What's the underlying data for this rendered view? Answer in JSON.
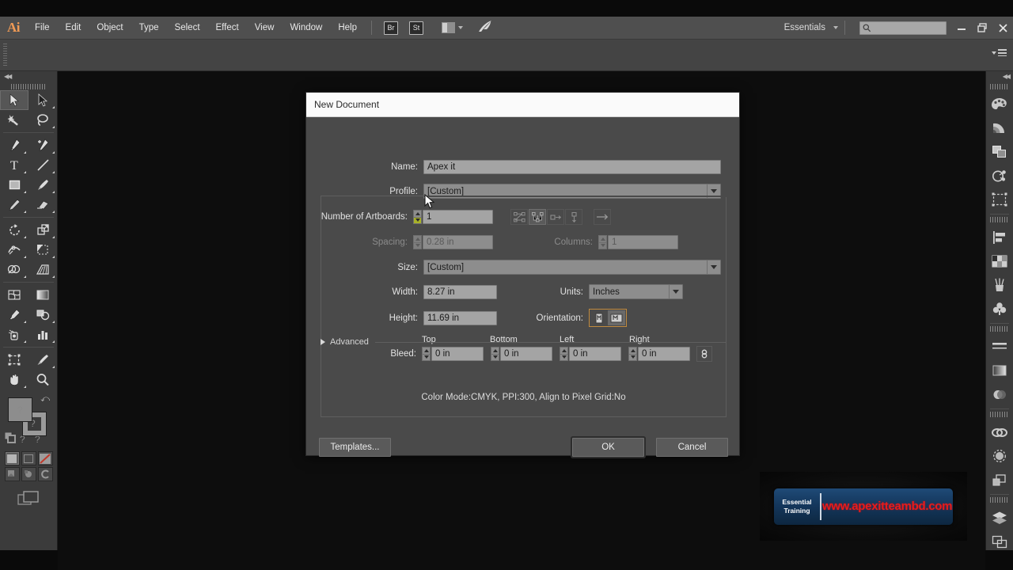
{
  "app": {
    "logo": "Ai",
    "menus": [
      "File",
      "Edit",
      "Object",
      "Type",
      "Select",
      "Effect",
      "View",
      "Window",
      "Help"
    ],
    "bridge_button": "Br",
    "stock_button": "St",
    "arrange_icon": "arrange-documents-icon",
    "feather_icon": "behance-feather-icon",
    "workspace": "Essentials",
    "search_placeholder": "",
    "search_value": "",
    "window_buttons": {
      "minimize": "–",
      "restore": "❐",
      "close": "✕"
    }
  },
  "toolbar": {
    "tools": [
      {
        "name": "selection-tool",
        "selected": true
      },
      {
        "name": "direct-selection-tool",
        "selected": false
      },
      {
        "name": "magic-wand-tool",
        "selected": false
      },
      {
        "name": "lasso-tool",
        "selected": false
      },
      {
        "name": "pen-tool",
        "selected": false
      },
      {
        "name": "add-anchor-point-tool",
        "selected": false
      },
      {
        "name": "type-tool",
        "selected": false
      },
      {
        "name": "line-segment-tool",
        "selected": false
      },
      {
        "name": "rectangle-tool",
        "selected": false
      },
      {
        "name": "paintbrush-tool",
        "selected": false
      },
      {
        "name": "pencil-tool",
        "selected": false
      },
      {
        "name": "eraser-tool",
        "selected": false
      },
      {
        "name": "rotate-tool",
        "selected": false
      },
      {
        "name": "scale-tool",
        "selected": false
      },
      {
        "name": "width-tool",
        "selected": false
      },
      {
        "name": "shape-builder-tool",
        "selected": false
      },
      {
        "name": "perspective-grid-tool",
        "selected": false
      },
      {
        "name": "mesh-tool",
        "selected": false
      },
      {
        "name": "gradient-tool",
        "selected": false
      },
      {
        "name": "eyedropper-tool",
        "selected": false
      },
      {
        "name": "blend-tool",
        "selected": false
      },
      {
        "name": "symbol-sprayer-tool",
        "selected": false
      },
      {
        "name": "column-graph-tool",
        "selected": false
      },
      {
        "name": "artboard-tool",
        "selected": false
      },
      {
        "name": "slice-tool",
        "selected": false
      },
      {
        "name": "hand-tool",
        "selected": false
      },
      {
        "name": "zoom-tool",
        "selected": false
      }
    ],
    "fill_color": "#8d8d8d",
    "stroke_color": "#9a9a9a",
    "color_modes": [
      "color-swatch",
      "gradient-swatch",
      "none-swatch"
    ],
    "draw_modes": [
      "draw-normal",
      "draw-behind",
      "draw-inside"
    ],
    "screen_mode": "change-screen-mode"
  },
  "dock": {
    "panels": [
      "color-panel",
      "color-guide-panel",
      "transform-panel",
      "pathfinder-panel",
      "align-panel",
      "align-objects-panel",
      "swatches-panel",
      "brushes-panel",
      "symbols-panel",
      "stroke-panel",
      "gradient-panel",
      "transparency-panel",
      "appearance-panel",
      "graphic-styles-panel",
      "layers-panel-alt",
      "layers-panel",
      "artboards-panel"
    ]
  },
  "dialog": {
    "title": "New Document",
    "fields": {
      "name_label": "Name:",
      "name_value": "Apex it",
      "profile_label": "Profile:",
      "profile_value": "[Custom]",
      "artboards_label": "Number of Artboards:",
      "artboards_value": "1",
      "spacing_label": "Spacing:",
      "spacing_value": "0.28 in",
      "columns_label": "Columns:",
      "columns_value": "1",
      "size_label": "Size:",
      "size_value": "[Custom]",
      "width_label": "Width:",
      "width_value": "8.27 in",
      "height_label": "Height:",
      "height_value": "11.69 in",
      "units_label": "Units:",
      "units_value": "Inches",
      "orientation_label": "Orientation:",
      "orientation_selected": "portrait",
      "bleed_label": "Bleed:",
      "bleed_top_label": "Top",
      "bleed_top_value": "0 in",
      "bleed_bottom_label": "Bottom",
      "bleed_bottom_value": "0 in",
      "bleed_left_label": "Left",
      "bleed_left_value": "0 in",
      "bleed_right_label": "Right",
      "bleed_right_value": "0 in"
    },
    "artboard_layout_buttons": [
      "grid-by-row-icon",
      "grid-by-column-icon",
      "arrange-by-row-icon",
      "arrange-by-column-icon"
    ],
    "artboard_direction_button": "left-to-right-icon",
    "advanced_label": "Advanced",
    "summary": "Color Mode:CMYK, PPI:300, Align to Pixel Grid:No",
    "buttons": {
      "templates": "Templates...",
      "ok": "OK",
      "cancel": "Cancel"
    }
  },
  "watermark": {
    "line1": "Essential",
    "line2": "Training",
    "url": "www.apexitteambd.com"
  },
  "colors": {
    "accent_orange": "#c08a3e",
    "menubar_bg": "#4f4f4f",
    "dialog_bg": "#4a4a4a",
    "title_bg": "#fafafa",
    "highlight_yellow": "#a8b228",
    "watermark_red": "#e81b1b"
  }
}
